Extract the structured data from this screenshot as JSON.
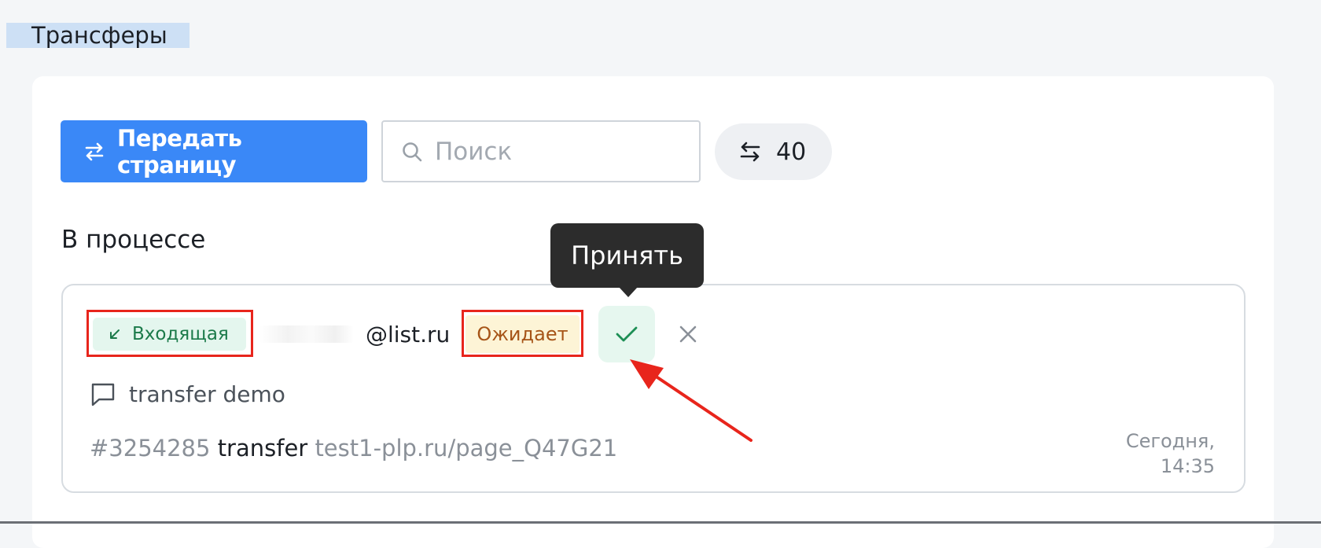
{
  "page": {
    "title": "Трансферы"
  },
  "toolbar": {
    "transfer_button_label": "Передать страницу",
    "transfer_icon": "transfer-arrows-icon",
    "search_placeholder": "Поиск",
    "search_value": "",
    "search_icon": "search-icon",
    "counter_icon": "transfer-arrows-icon",
    "counter_value": "40"
  },
  "section": {
    "title": "В процессе"
  },
  "tooltip": {
    "text": "Принять"
  },
  "transfer": {
    "direction_label": "Входящая",
    "direction_icon": "arrow-down-left-icon",
    "email_domain": "@list.ru",
    "status_label": "Ожидает",
    "accept_icon": "check-icon",
    "decline_icon": "close-icon",
    "comment_icon": "comment-icon",
    "comment": "transfer demo",
    "id": "#3254285",
    "action": "transfer",
    "page_url": "test1-plp.ru/page_Q47G21",
    "timestamp": "Сегодня, 14:35"
  },
  "colors": {
    "accent": "#3a88f7",
    "incoming_bg": "#e4f6ee",
    "incoming_text": "#1b7a4a",
    "pending_bg": "#fdf4d6",
    "pending_text": "#a65417",
    "annotation": "#e8251c"
  }
}
